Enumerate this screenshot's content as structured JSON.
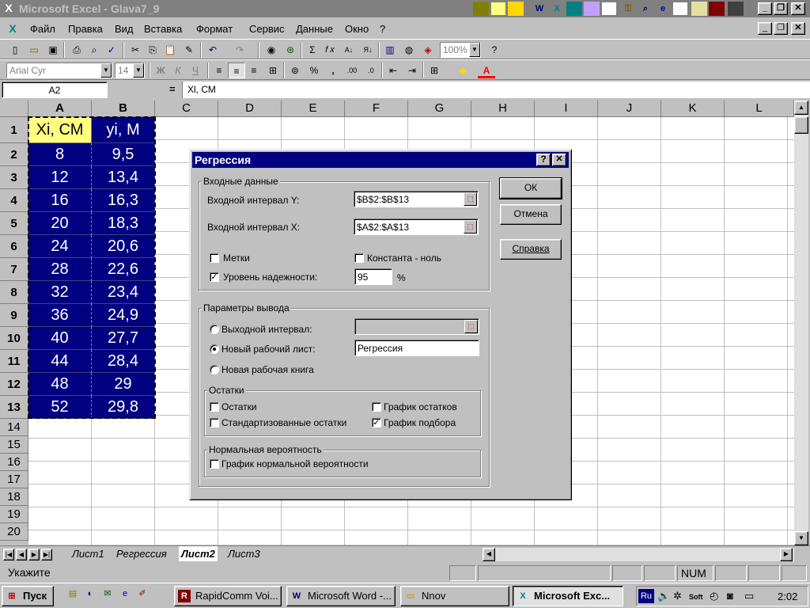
{
  "window": {
    "title": "Microsoft Excel - Glava7_9"
  },
  "menu": [
    {
      "label": "Файл"
    },
    {
      "label": "Правка"
    },
    {
      "label": "Вид"
    },
    {
      "label": "Вставка"
    },
    {
      "label": "Формат"
    },
    {
      "label": "Сервис"
    },
    {
      "label": "Данные"
    },
    {
      "label": "Окно"
    },
    {
      "label": "?"
    }
  ],
  "toolbar": {
    "zoom": "100%",
    "font": "Arial Cyr",
    "size": "14",
    "bold": "Ж",
    "italic": "К",
    "underline": "Ч",
    "sum": "Σ",
    "fx": "f x",
    "percent": "%",
    "comma": ","
  },
  "formula_bar": {
    "name_box": "A2",
    "equals": "=",
    "content": "Xl, СМ"
  },
  "columns": [
    "A",
    "B",
    "C",
    "D",
    "E",
    "F",
    "G",
    "H",
    "I",
    "J",
    "K",
    "L"
  ],
  "rows": [
    "1",
    "2",
    "3",
    "4",
    "5",
    "6",
    "7",
    "8",
    "9",
    "10",
    "11",
    "12",
    "13",
    "14",
    "15",
    "16",
    "17",
    "18",
    "19",
    "20"
  ],
  "sheet": {
    "header_x": "Xi, СМ",
    "header_y": "yi, М",
    "x_values": [
      "8",
      "12",
      "16",
      "20",
      "24",
      "28",
      "32",
      "36",
      "40",
      "44",
      "48",
      "52"
    ],
    "y_values": [
      "9,5",
      "13,4",
      "16,3",
      "18,3",
      "20,6",
      "22,6",
      "23,4",
      "24,9",
      "27,7",
      "28,4",
      "29",
      "29,8"
    ]
  },
  "dialog": {
    "title": "Регрессия",
    "help_glyph": "?",
    "close_glyph": "✕",
    "input_group": "Входные данные",
    "input_y_label": "Входной интервал Y:",
    "input_y_value": "$B$2:$B$13",
    "input_x_label": "Входной интервал X:",
    "input_x_value": "$A$2:$A$13",
    "labels_label": "Метки",
    "labels_checked": false,
    "const_zero_label": "Константа - ноль",
    "const_zero_checked": false,
    "confidence_label": "Уровень надежности:",
    "confidence_checked": true,
    "confidence_value": "95",
    "confidence_unit": "%",
    "output_group": "Параметры вывода",
    "output_range_label": "Выходной интервал:",
    "new_sheet_label": "Новый рабочий лист:",
    "new_sheet_value": "Регрессия",
    "new_book_label": "Новая рабочая книга",
    "residuals_group": "Остатки",
    "residuals_label": "Остатки",
    "std_residuals_label": "Стандартизованные остатки",
    "residual_plot_label": "График остатков",
    "fit_plot_label": "График подбора",
    "fit_plot_checked": true,
    "normal_group": "Нормальная вероятность",
    "normal_plot_label": "График нормальной вероятности",
    "ok": "ОК",
    "cancel": "Отмена",
    "help": "Справка",
    "checkmark": "✓"
  },
  "sheet_tabs": [
    "Лист1",
    "Регрессия",
    "Лист2",
    "Лист3"
  ],
  "active_tab": "Лист2",
  "status": {
    "mode": "Укажите",
    "num": "NUM"
  },
  "taskbar": {
    "start": "Пуск",
    "tasks": [
      "RapidComm Voi...",
      "Microsoft Word -...",
      "Nnov",
      "Microsoft Exc..."
    ],
    "lang": "Ru",
    "soft": "Soft",
    "clock": "2:02"
  }
}
